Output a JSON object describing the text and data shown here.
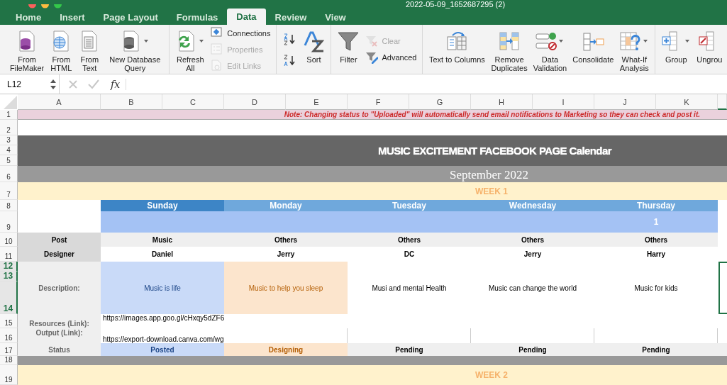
{
  "window": {
    "title": "2022-05-09_1652687295 (2)"
  },
  "tabs": [
    {
      "label": "Home",
      "selected": false
    },
    {
      "label": "Insert",
      "selected": false
    },
    {
      "label": "Page Layout",
      "selected": false
    },
    {
      "label": "Formulas",
      "selected": false
    },
    {
      "label": "Data",
      "selected": true
    },
    {
      "label": "Review",
      "selected": false
    },
    {
      "label": "View",
      "selected": false
    }
  ],
  "ribbon": {
    "groups": [
      {
        "items": [
          {
            "kind": "large",
            "label": "From FileMaker",
            "disabled": false,
            "dropdown": false
          },
          {
            "kind": "large",
            "label": "From HTML",
            "disabled": false,
            "dropdown": false
          },
          {
            "kind": "large",
            "label": "From Text",
            "disabled": false,
            "dropdown": false
          },
          {
            "kind": "large",
            "label": "New Database Query",
            "disabled": false,
            "dropdown": true
          }
        ]
      },
      {
        "items": [
          {
            "kind": "large",
            "label": "Refresh All",
            "disabled": false,
            "dropdown": true
          },
          {
            "kind": "small",
            "label": "Connections",
            "disabled": false
          },
          {
            "kind": "small",
            "label": "Properties",
            "disabled": true
          },
          {
            "kind": "small",
            "label": "Edit Links",
            "disabled": true
          }
        ]
      },
      {
        "items": [
          {
            "kind": "icon"
          },
          {
            "kind": "large",
            "label": "Sort",
            "disabled": false,
            "dropdown": false
          }
        ]
      },
      {
        "items": [
          {
            "kind": "large",
            "label": "Filter",
            "disabled": false,
            "dropdown": false
          },
          {
            "kind": "small",
            "label": "Clear",
            "disabled": true
          },
          {
            "kind": "small",
            "label": "Advanced",
            "disabled": false
          }
        ]
      },
      {
        "items": [
          {
            "kind": "large",
            "label": "Text to Columns",
            "disabled": false,
            "dropdown": false
          },
          {
            "kind": "large",
            "label": "Remove Duplicates",
            "disabled": false,
            "dropdown": false
          },
          {
            "kind": "large",
            "label": "Data Validation",
            "disabled": false,
            "dropdown": true
          },
          {
            "kind": "large",
            "label": "Consolidate",
            "disabled": false,
            "dropdown": false
          },
          {
            "kind": "large",
            "label": "What-If Analysis",
            "disabled": false,
            "dropdown": true
          }
        ]
      },
      {
        "items": [
          {
            "kind": "large",
            "label": "Group",
            "disabled": false,
            "dropdown": true
          },
          {
            "kind": "large",
            "label": "Ungrou",
            "disabled": false,
            "dropdown": false
          }
        ]
      }
    ]
  },
  "formula_bar": {
    "name_box": "L12",
    "function_label": "fx"
  },
  "columns": [
    {
      "label": "A"
    },
    {
      "label": "B"
    },
    {
      "label": "C"
    },
    {
      "label": "D"
    },
    {
      "label": "E"
    },
    {
      "label": "F"
    },
    {
      "label": "G"
    },
    {
      "label": "H"
    },
    {
      "label": "I"
    },
    {
      "label": "J"
    },
    {
      "label": "K"
    }
  ],
  "rows": [
    {
      "label": "1",
      "selected": false
    },
    {
      "label": "2",
      "selected": false
    },
    {
      "label": "3",
      "selected": false
    },
    {
      "label": "4",
      "selected": false
    },
    {
      "label": "5",
      "selected": false
    },
    {
      "label": "6",
      "selected": false
    },
    {
      "label": "7",
      "selected": false
    },
    {
      "label": "8",
      "selected": false
    },
    {
      "label": "9",
      "selected": false
    },
    {
      "label": "10",
      "selected": false
    },
    {
      "label": "11",
      "selected": false
    },
    {
      "label": "12",
      "selected": true
    },
    {
      "label": "13",
      "selected": true
    },
    {
      "label": "14",
      "selected": true
    },
    {
      "label": "15",
      "selected": false
    },
    {
      "label": "16",
      "selected": false
    },
    {
      "label": "17",
      "selected": false
    },
    {
      "label": "18",
      "selected": false
    },
    {
      "label": "19",
      "selected": false
    }
  ],
  "sheet": {
    "note": "Note: Changing status to \"Uploaded\" will automatically send email notifications to Marketing so they can check and post it.",
    "title": "MUSIC EXCITEMENT FACEBOOK PAGE Calendar",
    "month": "September 2022",
    "week_1": "WEEK 1",
    "week_2": "WEEK 2",
    "row_labels": {
      "post": "Post",
      "designer": "Designer",
      "description": "Description:",
      "resources": "Resources (Link):",
      "output": "Output (Link):",
      "status": "Status"
    },
    "days": [
      {
        "name": "Sunday",
        "color": "#3d85c6",
        "post": "Music",
        "designer": "Daniel",
        "description": "Music is life",
        "status": "Posted",
        "kind": "posted",
        "resource_link": "https://images.app.goo.gl/cHxqy5dZF6",
        "output_link": "https://export-download.canva.com/wg"
      },
      {
        "name": "Monday",
        "color": "#6fa8dc",
        "post": "Others",
        "designer": "Jerry",
        "description": "Music to help you sleep",
        "status": "Designing",
        "kind": "designing"
      },
      {
        "name": "Tuesday",
        "color": "#6fa8dc",
        "post": "Others",
        "designer": "DC",
        "description": "Musi and mental Health",
        "status": "Pending",
        "kind": "pending"
      },
      {
        "name": "Wednesday",
        "color": "#6fa8dc",
        "post": "Others",
        "designer": "Jerry",
        "description": "Music can change the world",
        "status": "Pending",
        "kind": "pending"
      },
      {
        "name": "Thursday",
        "color": "#6fa8dc",
        "date": "1",
        "post": "Others",
        "designer": "Harry",
        "description": "Music for kids",
        "status": "Pending",
        "kind": "pending"
      }
    ]
  }
}
